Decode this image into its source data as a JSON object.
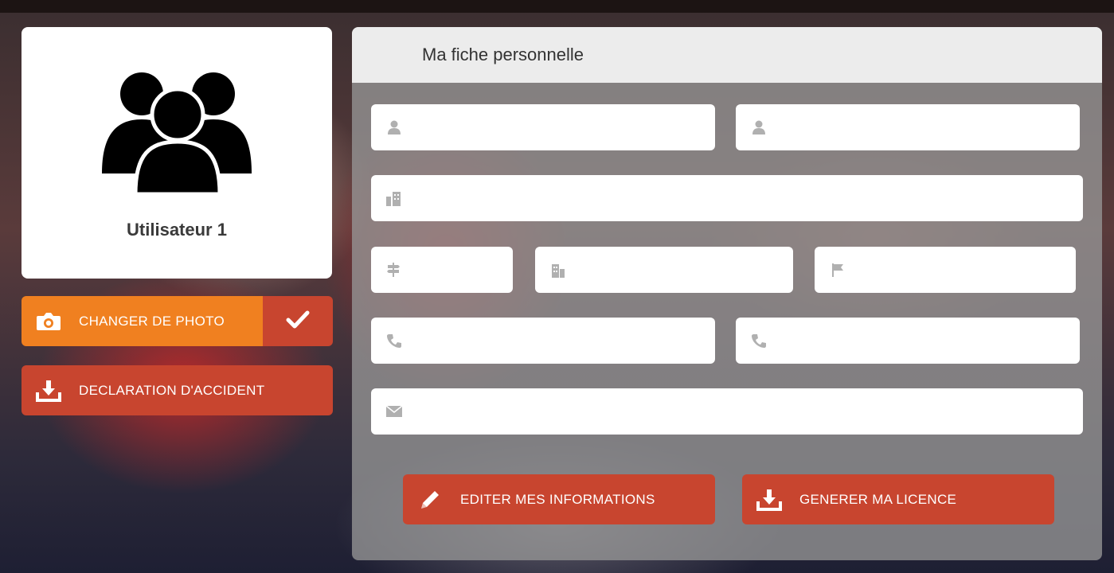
{
  "user_card": {
    "avatar_icon": "users-group-icon",
    "username": "Utilisateur 1"
  },
  "actions": {
    "change_photo_label": "CHANGER DE PHOTO",
    "change_photo_icon": "camera-icon",
    "confirm_icon": "check-icon",
    "accident_label": "DECLARATION D'ACCIDENT",
    "accident_icon": "download-icon"
  },
  "form": {
    "title": "Ma fiche personnelle",
    "fields": [
      {
        "name": "last-name",
        "icon": "user-icon",
        "value": ""
      },
      {
        "name": "first-name",
        "icon": "user-icon",
        "value": ""
      },
      {
        "name": "address",
        "icon": "building-icon",
        "value": ""
      },
      {
        "name": "postal-code",
        "icon": "signpost-icon",
        "value": ""
      },
      {
        "name": "city",
        "icon": "city-icon",
        "value": ""
      },
      {
        "name": "country",
        "icon": "flag-icon",
        "value": ""
      },
      {
        "name": "phone-1",
        "icon": "phone-icon",
        "value": ""
      },
      {
        "name": "phone-2",
        "icon": "phone-icon",
        "value": ""
      },
      {
        "name": "email",
        "icon": "envelope-icon",
        "value": ""
      }
    ],
    "edit_label": "EDITER MES INFORMATIONS",
    "edit_icon": "pencil-icon",
    "licence_label": "GENERER MA LICENCE",
    "licence_icon": "download-icon"
  },
  "colors": {
    "orange": "#f08020",
    "red": "#c8452f"
  }
}
